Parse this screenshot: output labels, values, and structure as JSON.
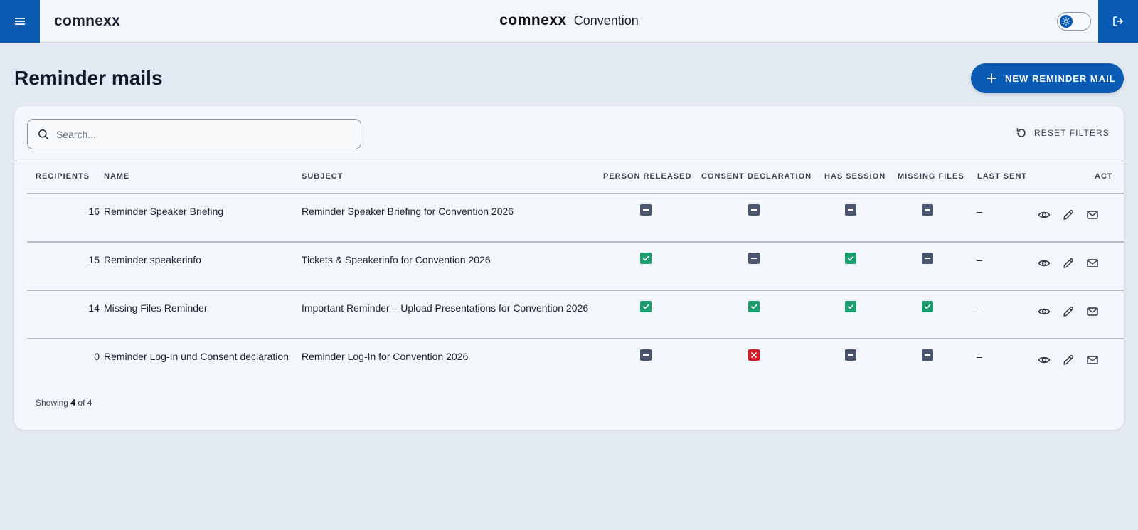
{
  "header": {
    "brand": "comnexx",
    "center_logo": "comnexx",
    "center_title": "Convention",
    "menu_icon": "hamburger-icon",
    "logout_icon": "logout-icon",
    "theme_toggle_icon": "sun-icon"
  },
  "page": {
    "title": "Reminder mails",
    "new_button_label": "NEW REMINDER MAIL"
  },
  "filters": {
    "search_placeholder": "Search...",
    "reset_label": "RESET FILTERS"
  },
  "table": {
    "columns": [
      "RECIPIENTS",
      "NAME",
      "SUBJECT",
      "PERSON RELEASED",
      "CONSENT DECLARATION",
      "HAS SESSION",
      "MISSING FILES",
      "LAST SENT",
      "ACT"
    ],
    "rows": [
      {
        "recipients": "16",
        "name": "Reminder Speaker Briefing",
        "subject": "Reminder Speaker Briefing for Convention 2026",
        "person_released": "indeterminate",
        "consent_declaration": "indeterminate",
        "has_session": "indeterminate",
        "missing_files": "indeterminate",
        "last_sent": "–"
      },
      {
        "recipients": "15",
        "name": "Reminder speakerinfo",
        "subject": "Tickets & Speakerinfo for Convention 2026",
        "person_released": "checked",
        "consent_declaration": "indeterminate",
        "has_session": "checked",
        "missing_files": "indeterminate",
        "last_sent": "–"
      },
      {
        "recipients": "14",
        "name": "Missing Files Reminder",
        "subject": "Important Reminder – Upload Presentations for Convention 2026",
        "person_released": "checked",
        "consent_declaration": "checked",
        "has_session": "checked",
        "missing_files": "checked",
        "last_sent": "–"
      },
      {
        "recipients": "0",
        "name": "Reminder Log-In und Consent declaration",
        "subject": "Reminder Log-In for Convention 2026",
        "person_released": "indeterminate",
        "consent_declaration": "unchecked-x",
        "has_session": "indeterminate",
        "missing_files": "indeterminate",
        "last_sent": "–"
      }
    ],
    "row_actions": [
      "view-icon",
      "edit-icon",
      "mail-icon"
    ]
  },
  "footer": {
    "showing_prefix": "Showing",
    "showing_count": "4",
    "showing_suffix": "of 4"
  },
  "colors": {
    "primary": "#0a5bb4",
    "checked": "#1a9c6d",
    "indeterminate": "#4a5670",
    "error": "#d41c2a",
    "background": "#e3e9f2"
  }
}
